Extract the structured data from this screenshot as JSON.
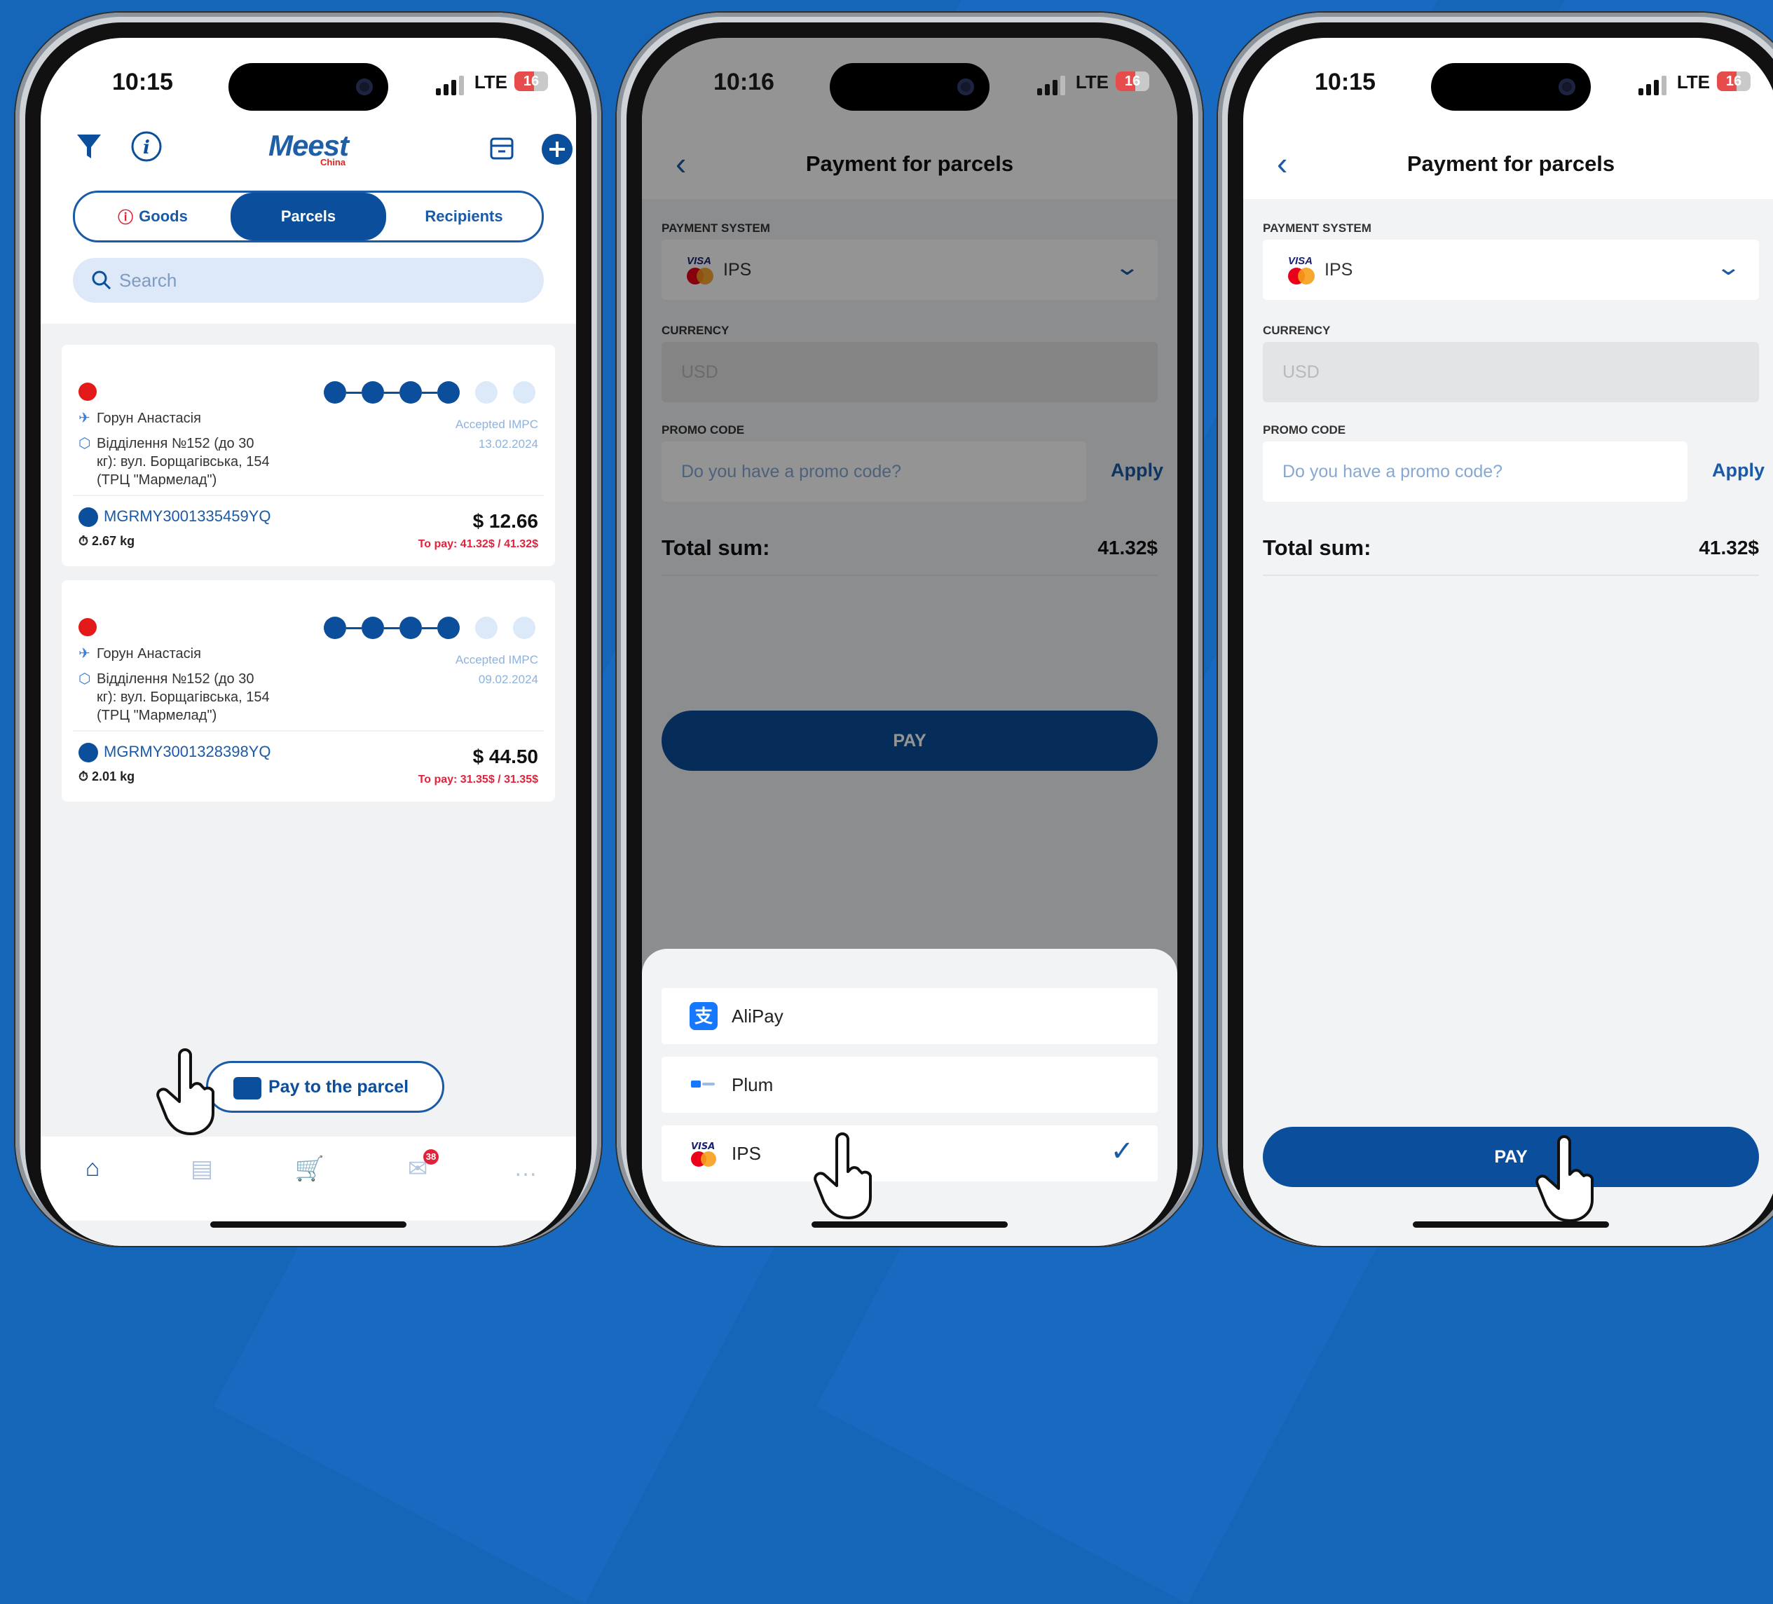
{
  "phone1": {
    "status": {
      "time": "10:15",
      "network": "LTE",
      "battery": "16"
    },
    "header": {
      "logo": "Meest",
      "logo_sub": "China"
    },
    "tabs": [
      {
        "label": "Goods",
        "active": false
      },
      {
        "label": "Parcels",
        "active": true
      },
      {
        "label": "Recipients",
        "active": false
      }
    ],
    "search": {
      "placeholder": "Search"
    },
    "parcels": [
      {
        "recipient": "Горун Анастасія",
        "branch_line1": "Відділення №152 (до 30",
        "branch_line2": "кг): вул. Борщагівська, 154",
        "branch_line3": "(ТРЦ \"Мармелад\")",
        "status": "Accepted IMPC",
        "date": "13.02.2024",
        "tracking": "MGRMY3001335459YQ",
        "weight": "2.67 kg",
        "price": "$ 12.66",
        "to_pay": "To pay: 41.32$ / 41.32$"
      },
      {
        "recipient": "Горун Анастасія",
        "branch_line1": "Відділення №152 (до 30",
        "branch_line2": "кг): вул. Борщагівська, 154",
        "branch_line3": "(ТРЦ \"Мармелад\")",
        "status": "Accepted IMPC",
        "date": "09.02.2024",
        "tracking": "MGRMY3001328398YQ",
        "weight": "2.01 kg",
        "price": "$ 44.50",
        "to_pay": "To pay: 31.35$ / 31.35$"
      }
    ],
    "pay_button": "Pay to the parcel",
    "bottom_tabs": {
      "messages_badge": "38"
    }
  },
  "phone2": {
    "status": {
      "time": "10:16",
      "network": "LTE",
      "battery": "16"
    },
    "title": "Payment for parcels",
    "payment_system_label": "PAYMENT SYSTEM",
    "payment_system_value": "IPS",
    "currency_label": "CURRENCY",
    "currency_value": "USD",
    "promo_label": "PROMO CODE",
    "promo_placeholder": "Do you have a promo code?",
    "apply": "Apply",
    "total_label": "Total sum:",
    "total_value": "41.32$",
    "pay": "PAY",
    "options": [
      {
        "label": "AliPay",
        "selected": false
      },
      {
        "label": "Plum",
        "selected": false
      },
      {
        "label": "IPS",
        "selected": true
      }
    ]
  },
  "phone3": {
    "status": {
      "time": "10:15",
      "network": "LTE",
      "battery": "16"
    },
    "title": "Payment for parcels",
    "payment_system_label": "PAYMENT SYSTEM",
    "payment_system_value": "IPS",
    "currency_label": "CURRENCY",
    "currency_value": "USD",
    "promo_label": "PROMO CODE",
    "promo_placeholder": "Do you have a promo code?",
    "apply": "Apply",
    "total_label": "Total sum:",
    "total_value": "41.32$",
    "pay": "PAY"
  },
  "colors": {
    "brand": "#0b4f9c",
    "accent_red": "#e2223a",
    "background": "#1565b8"
  }
}
